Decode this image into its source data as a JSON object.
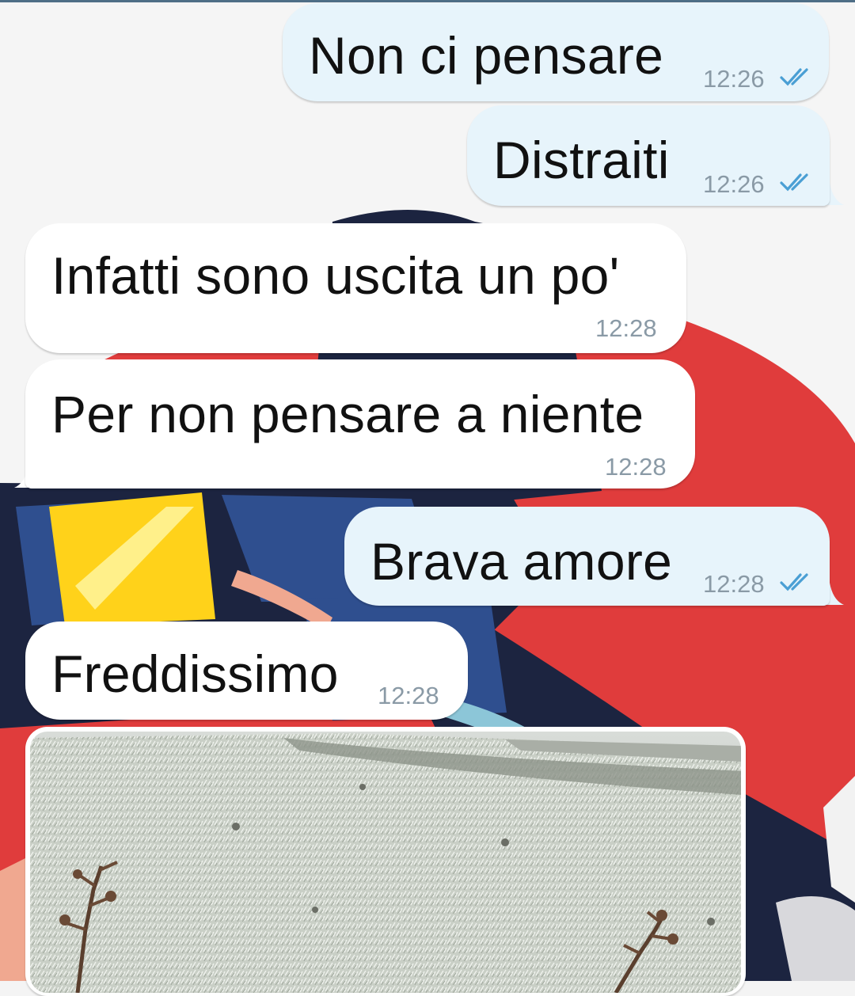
{
  "messages": [
    {
      "direction": "out",
      "text": "Non ci pensare",
      "time": "12:26",
      "status": "read"
    },
    {
      "direction": "out",
      "text": "Distraiti",
      "time": "12:26",
      "status": "read"
    },
    {
      "direction": "in",
      "text": "Infatti sono uscita un po'",
      "time": "12:28"
    },
    {
      "direction": "in",
      "text": "Per non pensare a niente",
      "time": "12:28"
    },
    {
      "direction": "out",
      "text": "Brava amore",
      "time": "12:28",
      "status": "read"
    },
    {
      "direction": "in",
      "text": "Freddissimo",
      "time": "12:28"
    },
    {
      "direction": "in",
      "type": "image",
      "image_desc": "photo of frosty grass field"
    }
  ],
  "colors": {
    "outgoing_bubble": "#e7f4fb",
    "incoming_bubble": "#ffffff",
    "read_ticks": "#4a9fd4",
    "timestamp": "#8a9aa6",
    "wallpaper_red": "#e03c3c",
    "wallpaper_navy": "#1c2440",
    "wallpaper_yellow": "#ffd21a"
  },
  "icons": {
    "read_status": "double-check-icon"
  }
}
